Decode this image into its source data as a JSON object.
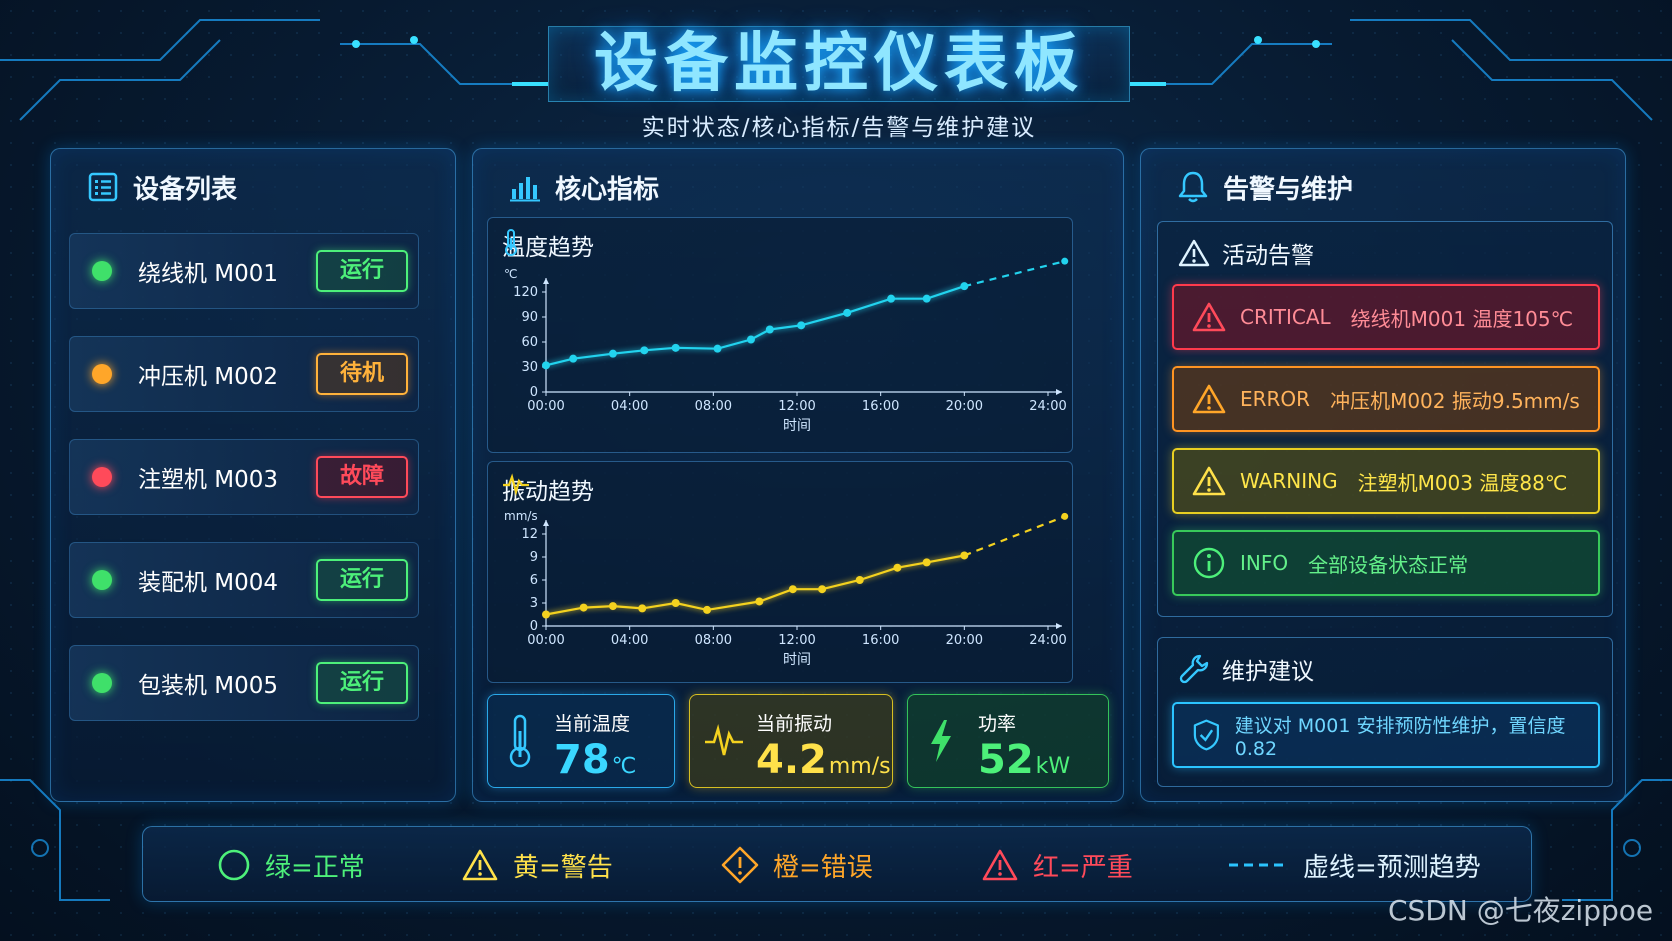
{
  "header": {
    "title": "设备监控仪表板",
    "subtitle": "实时状态/核心指标/告警与维护建议"
  },
  "devices": {
    "heading": "设备列表",
    "items": [
      {
        "name": "绕线机 M001",
        "status": "运行",
        "color": "#3fe06a"
      },
      {
        "name": "冲压机 M002",
        "status": "待机",
        "color": "#ffa629"
      },
      {
        "name": "注塑机 M003",
        "status": "故障",
        "color": "#ff4a5a"
      },
      {
        "name": "装配机 M004",
        "status": "运行",
        "color": "#3fe06a"
      },
      {
        "name": "包装机 M005",
        "status": "运行",
        "color": "#3fe06a"
      }
    ]
  },
  "metrics": {
    "heading": "核心指标",
    "temp_chart_title": "温度趋势",
    "vib_chart_title": "振动趋势",
    "cards": {
      "temp": {
        "label": "当前温度",
        "value": "78",
        "unit": "℃"
      },
      "vib": {
        "label": "当前振动",
        "value": "4.2",
        "unit": "mm/s"
      },
      "power": {
        "label": "功率",
        "value": "52",
        "unit": "kW"
      }
    }
  },
  "chart_data": [
    {
      "type": "line",
      "title": "温度趋势",
      "xlabel": "时间",
      "ylabel": "℃",
      "xticks": [
        "00:00",
        "04:00",
        "08:00",
        "12:00",
        "16:00",
        "20:00",
        "24:00"
      ],
      "yticks": [
        0,
        30,
        60,
        90,
        120
      ],
      "xlim": [
        0,
        24
      ],
      "ylim": [
        0,
        120
      ],
      "color": "#22d3ee",
      "series": [
        {
          "x": [
            0,
            1.3,
            3.2,
            4.7,
            6.2,
            8.2,
            9.8,
            10.7,
            12.2,
            14.4,
            16.5,
            18.2,
            20.0
          ],
          "y": [
            32,
            40,
            46,
            50,
            53,
            52,
            63,
            75,
            80,
            95,
            112,
            112,
            127
          ]
        }
      ],
      "forecast": {
        "x": [
          20.0,
          24.8
        ],
        "y": [
          127,
          157
        ]
      },
      "grid": false
    },
    {
      "type": "line",
      "title": "振动趋势",
      "xlabel": "时间",
      "ylabel": "mm/s",
      "xticks": [
        "00:00",
        "04:00",
        "08:00",
        "12:00",
        "16:00",
        "20:00",
        "24:00"
      ],
      "yticks": [
        0,
        3,
        6,
        9,
        12
      ],
      "xlim": [
        0,
        24
      ],
      "ylim": [
        0,
        12
      ],
      "color": "#f4d21f",
      "series": [
        {
          "x": [
            0,
            1.8,
            3.2,
            4.6,
            6.2,
            7.7,
            10.2,
            11.8,
            13.2,
            15.0,
            16.8,
            18.2,
            20.0
          ],
          "y": [
            1.5,
            2.4,
            2.6,
            2.3,
            3.0,
            2.1,
            3.2,
            4.8,
            4.8,
            6.0,
            7.6,
            8.3,
            9.2
          ]
        }
      ],
      "forecast": {
        "x": [
          20.0,
          24.8
        ],
        "y": [
          9.2,
          14.3
        ]
      },
      "grid": false
    }
  ],
  "alerts": {
    "heading": "告警与维护",
    "active_heading": "活动告警",
    "items": [
      {
        "level": "CRITICAL",
        "text": "绕线机M001 温度105℃",
        "kind": "crit"
      },
      {
        "level": "ERROR",
        "text": "冲压机M002 振动9.5mm/s",
        "kind": "err"
      },
      {
        "level": "WARNING",
        "text": "注塑机M003 温度88℃",
        "kind": "warn"
      },
      {
        "level": "INFO",
        "text": "全部设备状态正常",
        "kind": "info"
      }
    ],
    "maintenance_heading": "维护建议",
    "maintenance_text": "建议对 M001 安排预防性维护，置信度 0.82"
  },
  "legend": {
    "green": "绿=正常",
    "yellow": "黄=警告",
    "orange": "橙=错误",
    "red": "红=严重",
    "dashed": "虚线=预测趋势"
  },
  "watermark": "CSDN @七夜zippoe",
  "colors": {
    "accent": "#2bc4ff",
    "green": "#3fe06a",
    "yellow": "#f4d21f",
    "orange": "#ff9b22",
    "red": "#ff3a4c",
    "cyan": "#22d3ee"
  }
}
